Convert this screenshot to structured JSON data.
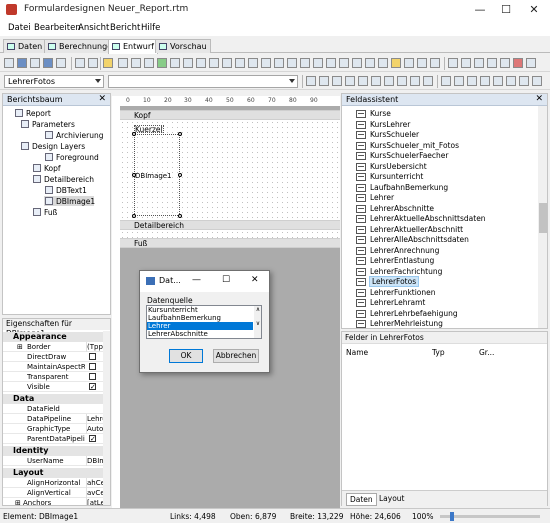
{
  "window": {
    "title": "Formulardesignen Neuer_Report.rtm",
    "minimize": "—",
    "maximize": "☐",
    "close": "✕"
  },
  "menu": [
    "Datei",
    "Bearbeiten",
    "Ansicht",
    "Bericht",
    "Hilfe"
  ],
  "tabs": [
    "Daten",
    "Berechnungen",
    "Entwurf",
    "Vorschau"
  ],
  "active_tab": "Entwurf",
  "pipeline_combo": {
    "value": "LehrerFotos"
  },
  "report_tree": {
    "header": "Berichtsbaum",
    "items": [
      "Report",
      "Parameters",
      "Archivierung",
      "Design Layers",
      "Foreground",
      "Kopf",
      "Detailbereich",
      "DBText1",
      "DBImage1",
      "Fuß"
    ]
  },
  "properties": {
    "header": "Eigenschaften für DBImage1",
    "categories": [
      {
        "name": "Appearance",
        "rows": [
          {
            "name": "Border",
            "value": "(TppB",
            "expander": "⊞"
          },
          {
            "name": "DirectDraw",
            "check": false
          },
          {
            "name": "MaintainAspectRa",
            "check": false
          },
          {
            "name": "Transparent",
            "check": false
          },
          {
            "name": "Visible",
            "check": true
          }
        ]
      },
      {
        "name": "Data",
        "rows": [
          {
            "name": "DataField",
            "value": ""
          },
          {
            "name": "DataPipeline",
            "value": "Lehre"
          },
          {
            "name": "GraphicType",
            "value": "Auto"
          },
          {
            "name": "ParentDataPipeline",
            "check": true
          }
        ]
      },
      {
        "name": "Identity",
        "rows": [
          {
            "name": "UserName",
            "value": "DBIm"
          }
        ]
      },
      {
        "name": "Layout",
        "rows": [
          {
            "name": "AlignHorizontal",
            "value": "ahCe"
          },
          {
            "name": "AlignVertical",
            "value": "avCe"
          },
          {
            "name": "Anchors",
            "value": "[atLe",
            "expander": "⊞"
          }
        ]
      }
    ]
  },
  "design": {
    "ruler_marks": [
      "0",
      "10",
      "20",
      "30",
      "40",
      "50",
      "60",
      "70",
      "80",
      "90"
    ],
    "bands": {
      "header": "Kopf",
      "detail": "Detailbereich",
      "footer": "Fuß"
    },
    "components": {
      "text": "Kuerzel",
      "image": "DBImage1"
    }
  },
  "field_assistant": {
    "header": "Feldassistent",
    "items": [
      "Kurse",
      "KursLehrer",
      "KursSchueler",
      "KursSchueler_mit_Fotos",
      "KursSchuelerFaecher",
      "KursUebersicht",
      "Kursunterricht",
      "LaufbahnBemerkung",
      "Lehrer",
      "LehrerAbschnitte",
      "LehrerAktuelleAbschnittsdaten",
      "LehrerAktuellerAbschnitt",
      "LehrerAlleAbschnittsdaten",
      "LehrerAnrechnung",
      "LehrerEntlastung",
      "LehrerFachrichtung",
      "LehrerFotos",
      "LehrerFunktionen",
      "LehrerLehramt",
      "LehrerLehrbefaehigung",
      "LehrerMehrleistung"
    ],
    "selected": "LehrerFotos",
    "fields_header": "Felder in LehrerFotos",
    "columns": [
      "Name",
      "Typ",
      "Gr..."
    ],
    "bottom_tabs": [
      "Daten",
      "Layout"
    ]
  },
  "dialog": {
    "title": "Dat...",
    "label": "Datenquelle",
    "options": [
      "Kursunterricht",
      "LaufbahnBemerkung",
      "Lehrer",
      "LehrerAbschnitte"
    ],
    "selected": "Lehrer",
    "ok": "OK",
    "cancel": "Abbrechen"
  },
  "status": {
    "element": "Element: DBImage1",
    "links": "Links: 4,498",
    "oben": "Oben: 6,879",
    "breite": "Breite: 13,229",
    "hoehe": "Höhe: 24,606",
    "zoom": "100%"
  },
  "colors": {
    "selection": "#0078d7",
    "panel_header": "#dde6f1"
  }
}
